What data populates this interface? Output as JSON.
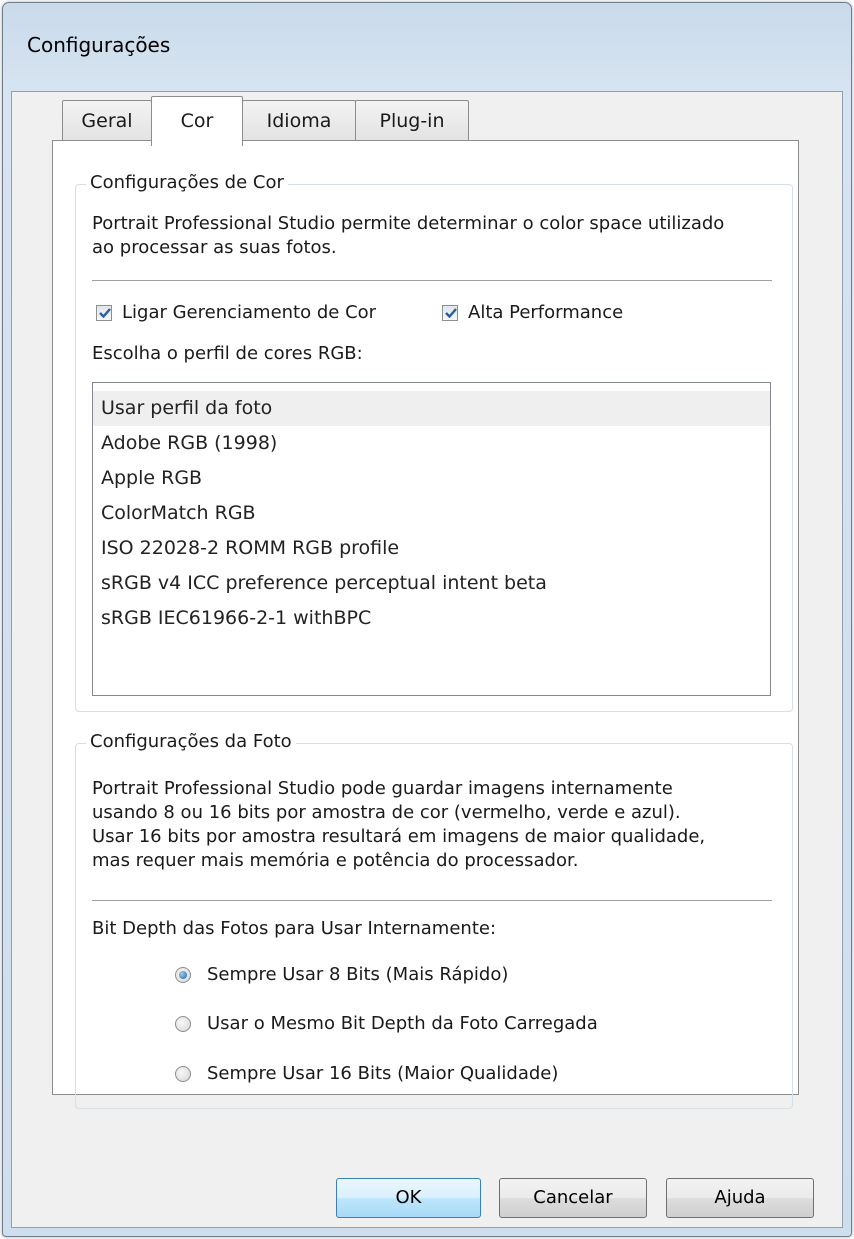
{
  "window": {
    "title": "Configurações"
  },
  "tabs": [
    {
      "label": "Geral",
      "active": false
    },
    {
      "label": "Cor",
      "active": true
    },
    {
      "label": "Idioma",
      "active": false
    },
    {
      "label": "Plug-in",
      "active": false
    }
  ],
  "color_settings": {
    "group_title": "Configurações de Cor",
    "description_lines": [
      "Portrait Professional Studio permite determinar o color space utilizado",
      "ao processar as suas fotos."
    ],
    "checkboxes": [
      {
        "label": "Ligar Gerenciamento de Cor",
        "checked": true
      },
      {
        "label": "Alta Performance",
        "checked": true
      }
    ],
    "profile_label": "Escolha o perfil de cores RGB:",
    "profiles": [
      "Usar perfil da foto",
      "Adobe RGB (1998)",
      "Apple RGB",
      "ColorMatch RGB",
      "ISO 22028-2 ROMM RGB profile",
      "sRGB v4 ICC preference perceptual intent beta",
      "sRGB IEC61966-2-1 withBPC"
    ],
    "selected_profile": "Usar perfil da foto"
  },
  "photo_settings": {
    "group_title": "Configurações da Foto",
    "description_lines": [
      "Portrait Professional Studio pode guardar imagens  internamente",
      "usando  8 ou 16 bits por amostra de cor (vermelho, verde e azul).",
      "Usar 16 bits por amostra resultará em imagens de maior qualidade,",
      "mas requer mais memória e potência do processador."
    ],
    "bit_depth_label": "Bit Depth das Fotos para Usar Internamente:",
    "options": [
      {
        "label": "Sempre Usar 8 Bits (Mais Rápido)",
        "checked": true
      },
      {
        "label": "Usar o Mesmo Bit Depth da Foto Carregada",
        "checked": false
      },
      {
        "label": "Sempre Usar 16 Bits (Maior Qualidade)",
        "checked": false
      }
    ]
  },
  "buttons": {
    "ok": "OK",
    "cancel": "Cancelar",
    "help": "Ajuda"
  }
}
